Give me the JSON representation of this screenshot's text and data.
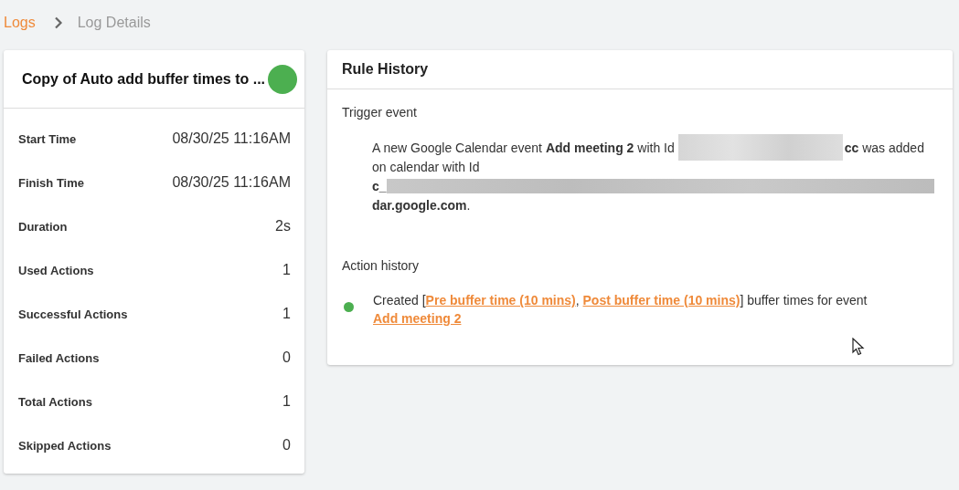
{
  "breadcrumb": [
    {
      "label": "Logs",
      "kind": "link"
    },
    {
      "label": "Log Details",
      "kind": "current"
    }
  ],
  "rule_card": {
    "title": "Copy of Auto add buffer times to ...",
    "color": "#4caf50",
    "fields": [
      {
        "label": "Start Time",
        "value": "08/30/25 11:16AM"
      },
      {
        "label": "Finish Time",
        "value": "08/30/25 11:16AM"
      },
      {
        "label": "Duration",
        "value": "2s"
      },
      {
        "label": "Used Actions",
        "value": "1"
      },
      {
        "label": "Successful Actions",
        "value": "1"
      },
      {
        "label": "Failed Actions",
        "value": "0"
      },
      {
        "label": "Total Actions",
        "value": "1"
      },
      {
        "label": "Skipped Actions",
        "value": "0"
      }
    ]
  },
  "rule_history": {
    "title": "Rule History",
    "trigger": {
      "heading": "Trigger event",
      "lines": [
        [
          {
            "kind": "text",
            "text": "A new Google Calendar event **Add meeting 2** with Id"
          },
          {
            "kind": "redacted"
          },
          {
            "kind": "text",
            "text": "**cc** was added"
          }
        ],
        [
          {
            "kind": "text",
            "text": "on calendar with Id"
          }
        ],
        [
          {
            "kind": "text",
            "text": "**c_**"
          },
          {
            "kind": "redacted"
          }
        ],
        [
          {
            "kind": "text",
            "text": "**dar.google.com**."
          }
        ]
      ]
    },
    "actions": {
      "heading": "Action history",
      "items": [
        {
          "color": "#4caf50",
          "segments": [
            {
              "kind": "text",
              "text": "Created ["
            },
            {
              "kind": "link",
              "text": "Pre buffer time (10 mins)"
            },
            {
              "kind": "text",
              "text": ", "
            },
            {
              "kind": "link",
              "text": "Post buffer time (10 mins)"
            },
            {
              "kind": "text",
              "text": "] buffer times for event "
            },
            {
              "kind": "link",
              "text": "Add meeting 2"
            }
          ]
        }
      ]
    }
  }
}
